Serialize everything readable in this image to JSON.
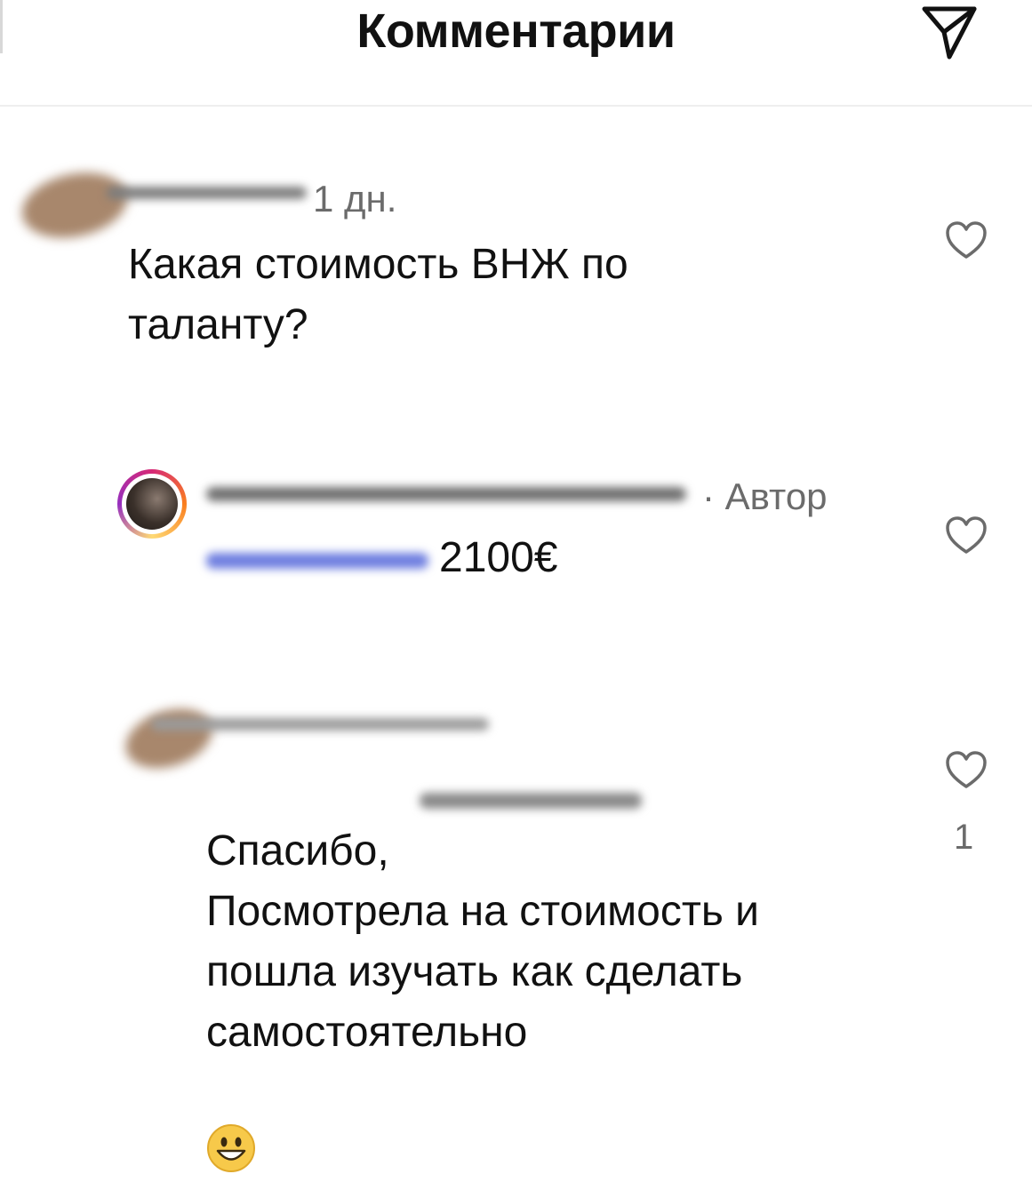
{
  "header": {
    "title": "Комментарии",
    "share_icon": "send-paper-plane-icon"
  },
  "comments": [
    {
      "time": "1 дн.",
      "text": "Какая стоимость ВНЖ по\nталанту?",
      "like_icon": "heart-outline-icon"
    },
    {
      "author_tag": "· Автор",
      "text": "2100€",
      "like_icon": "heart-outline-icon"
    },
    {
      "text_line1": "Спасибо,",
      "text_rest": "Посмотрела на стоимость и\nпошла изучать как сделать\nсамостоятельно",
      "emoji_icon": "smiling-face-emoji-icon",
      "like_icon": "heart-outline-icon",
      "like_count": "1"
    }
  ],
  "colors": {
    "text": "#111111",
    "secondary_text": "#6b6b6b",
    "divider": "#eeeeee"
  }
}
